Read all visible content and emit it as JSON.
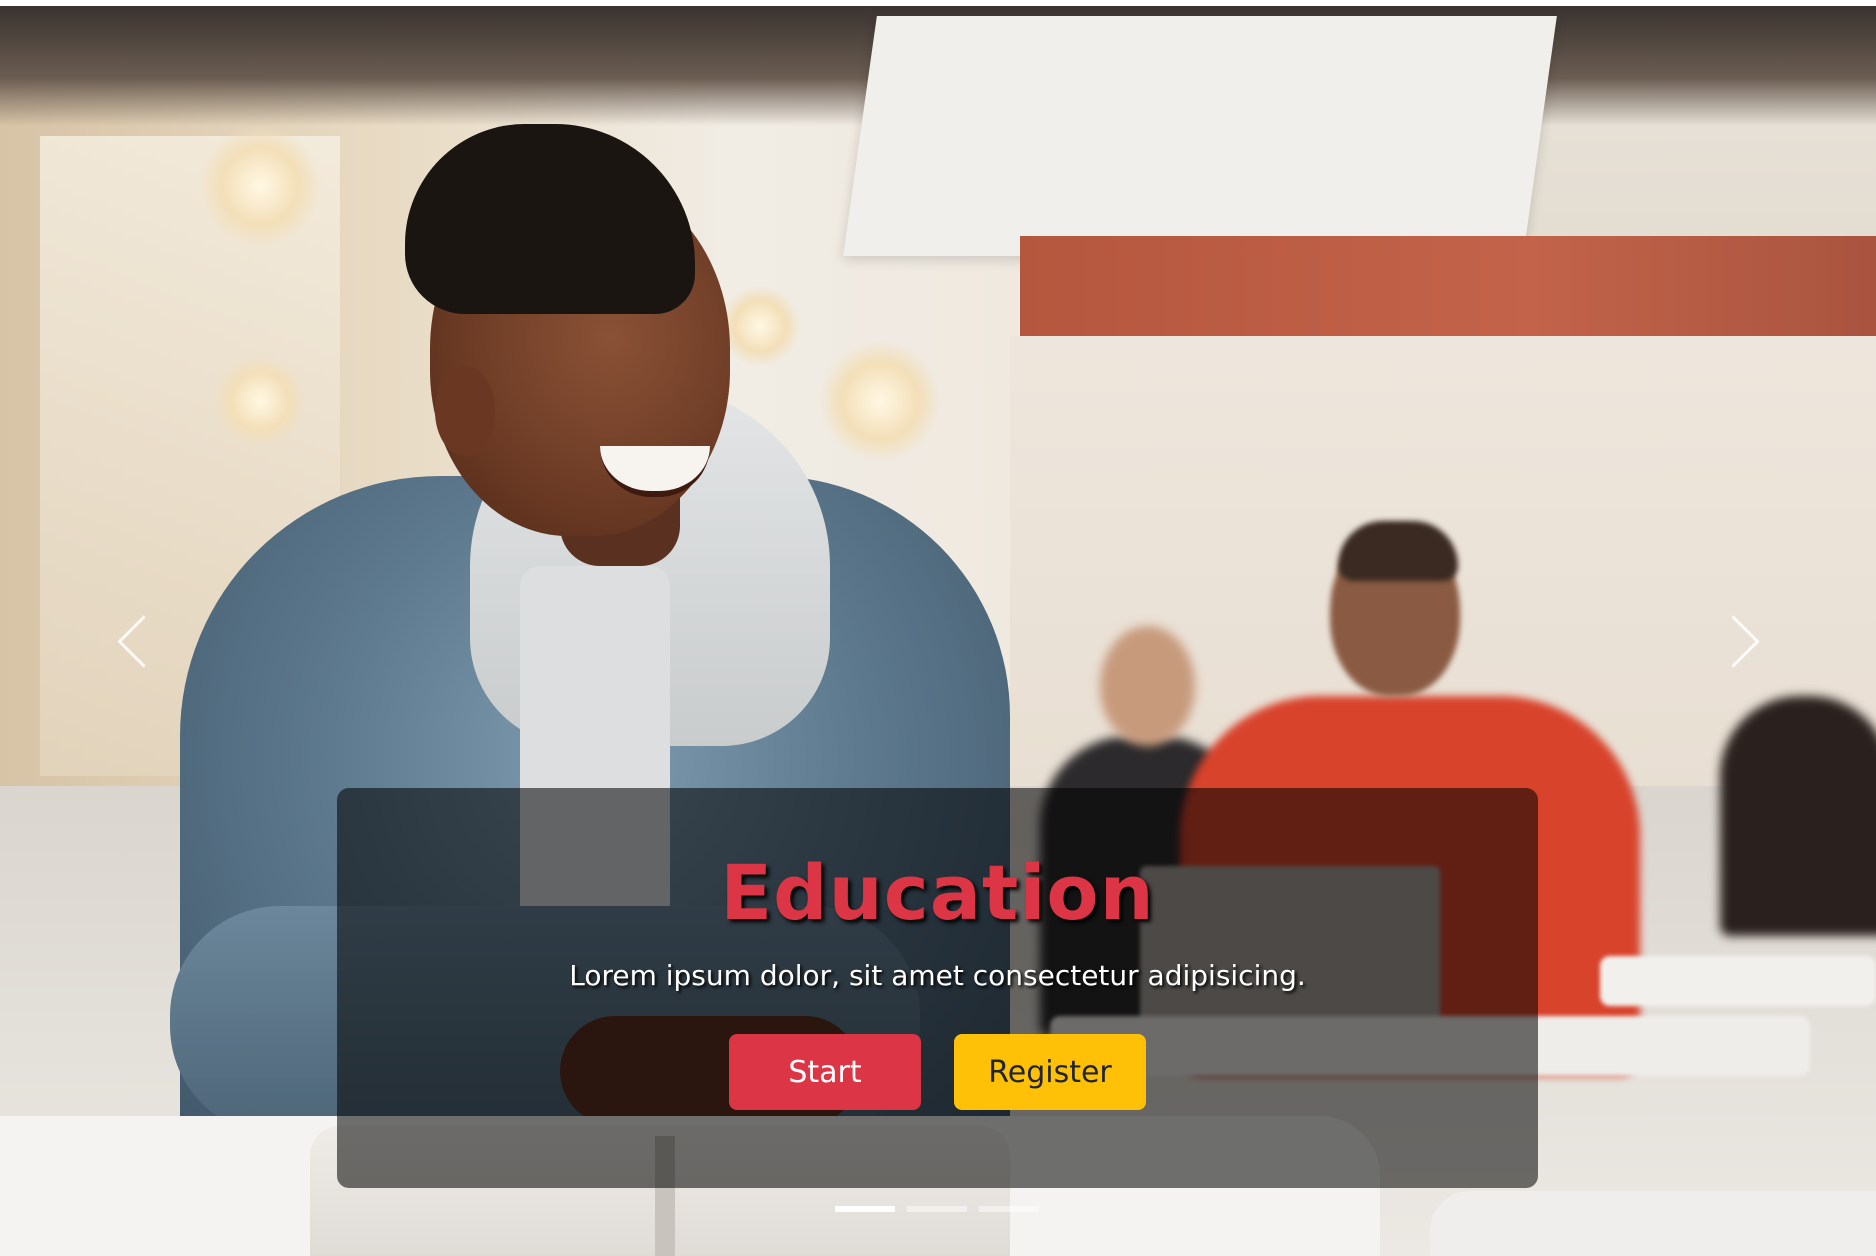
{
  "hero": {
    "title": "Education",
    "subtitle": "Lorem ipsum dolor, sit amet consectetur adipisicing.",
    "buttons": {
      "start_label": "Start",
      "register_label": "Register"
    },
    "title_color": "#dc3545",
    "start_color": "#dc3545",
    "register_color": "#ffc107"
  },
  "carousel": {
    "prev_icon": "chevron-left-icon",
    "next_icon": "chevron-right-icon",
    "slide_count": 3,
    "active_index": 0
  }
}
